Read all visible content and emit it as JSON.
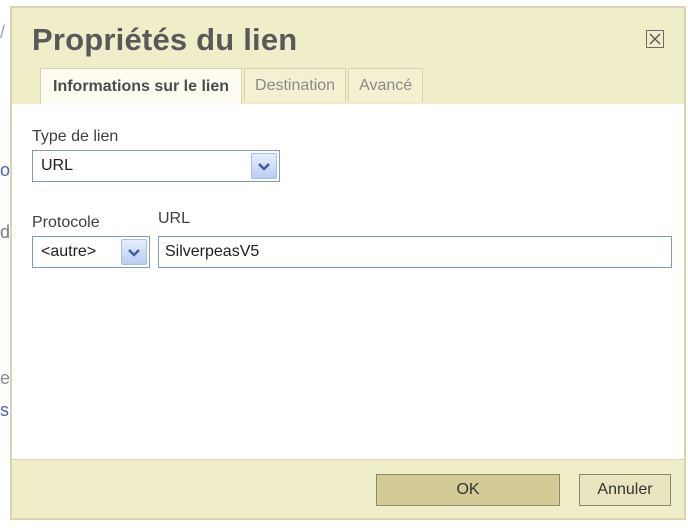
{
  "background": {
    "glyphs": [
      "/",
      "o",
      "d",
      "e",
      "s"
    ]
  },
  "dialog": {
    "title": "Propriétés du lien",
    "close_glyph": "⊠",
    "tabs": [
      {
        "label": "Informations sur le lien",
        "active": true
      },
      {
        "label": "Destination",
        "active": false
      },
      {
        "label": "Avancé",
        "active": false
      }
    ],
    "link_type": {
      "label": "Type de lien",
      "value": "URL"
    },
    "protocol": {
      "label": "Protocole",
      "value": "<autre>"
    },
    "url": {
      "label": "URL",
      "value": "SilverpeasV5"
    },
    "buttons": {
      "ok": "OK",
      "cancel": "Annuler"
    }
  },
  "colors": {
    "title_bar": "#f0eec8",
    "accent_border": "#7f9db9",
    "ok_button": "#d2cb95"
  }
}
